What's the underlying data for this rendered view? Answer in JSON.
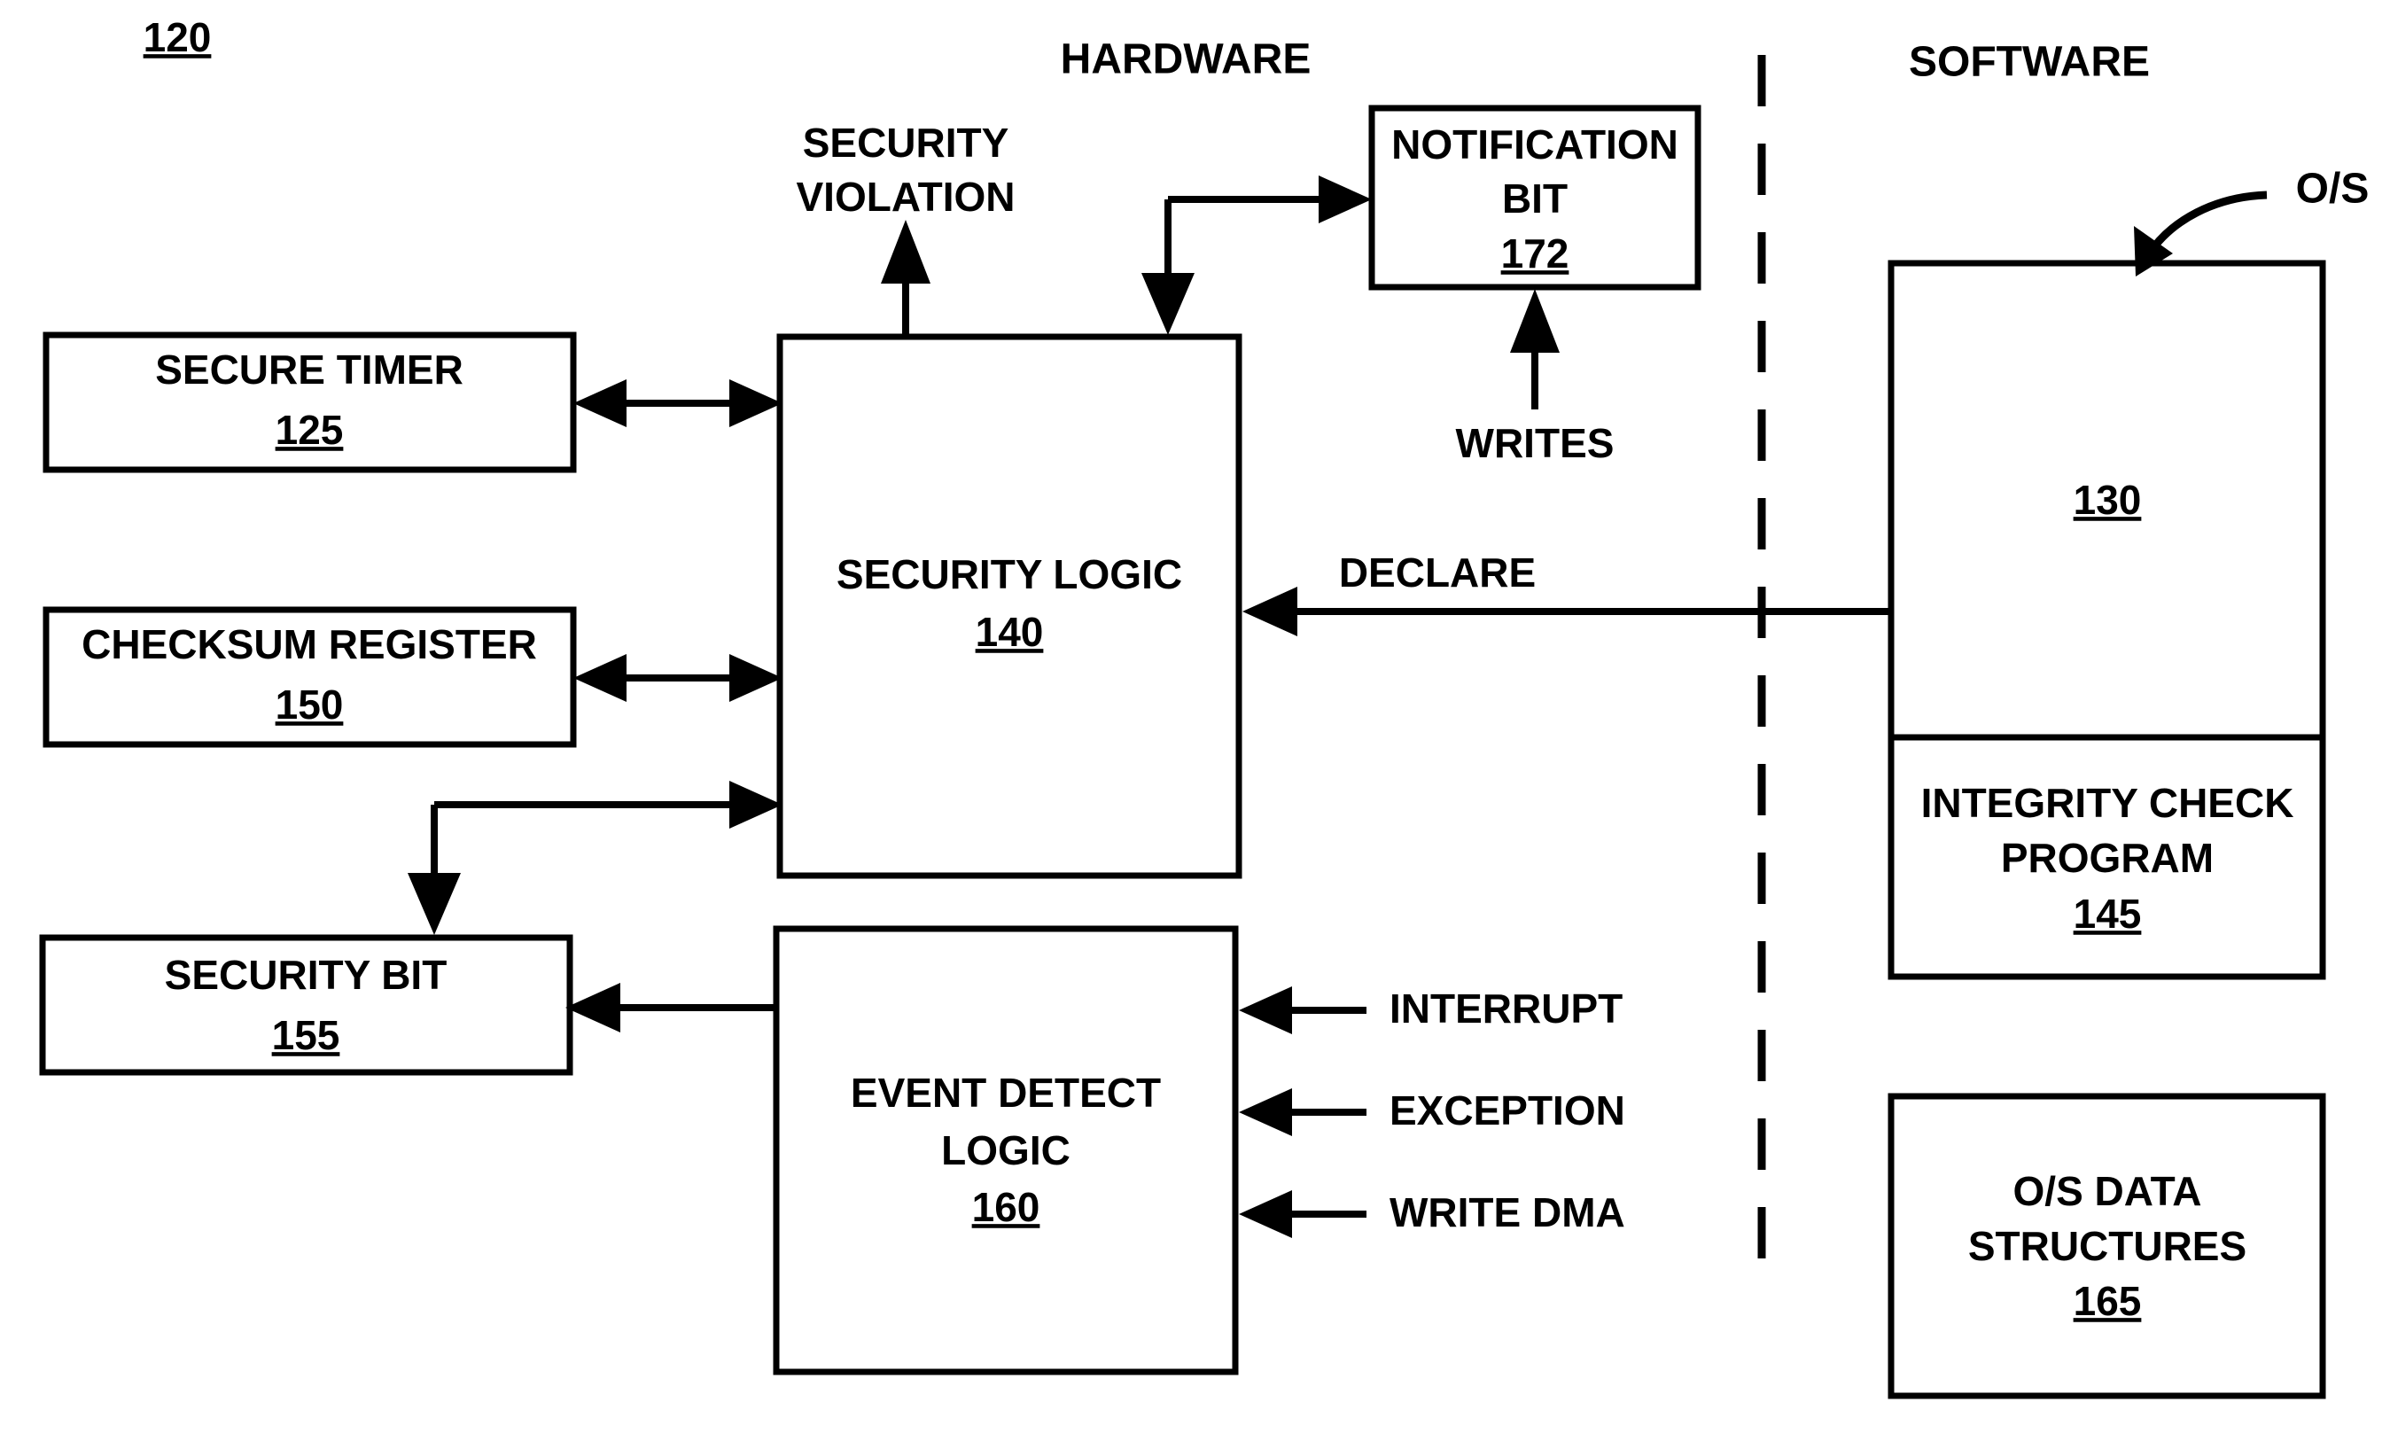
{
  "figure": {
    "figure_number": "120",
    "domain_headers": {
      "hardware": "HARDWARE",
      "software": "SOFTWARE"
    },
    "os_callout": "O/S"
  },
  "boxes": {
    "secure_timer": {
      "title": "SECURE TIMER",
      "ref": "125"
    },
    "checksum_register": {
      "title": "CHECKSUM REGISTER",
      "ref": "150"
    },
    "security_bit": {
      "title": "SECURITY BIT",
      "ref": "155"
    },
    "security_logic": {
      "title": "SECURITY LOGIC",
      "ref": "140"
    },
    "event_detect_logic": {
      "title_line1": "EVENT DETECT",
      "title_line2": "LOGIC",
      "ref": "160"
    },
    "notification_bit": {
      "title_line1": "NOTIFICATION",
      "title_line2": "BIT",
      "ref": "172"
    },
    "os": {
      "ref": "130"
    },
    "integrity_check_program": {
      "title_line1": "INTEGRITY CHECK",
      "title_line2": "PROGRAM",
      "ref": "145"
    },
    "os_data_structures": {
      "title_line1": "O/S DATA",
      "title_line2": "STRUCTURES",
      "ref": "165"
    }
  },
  "signals": {
    "security_violation_line1": "SECURITY",
    "security_violation_line2": "VIOLATION",
    "writes": "WRITES",
    "declare": "DECLARE",
    "interrupt": "INTERRUPT",
    "exception": "EXCEPTION",
    "write_dma": "WRITE DMA"
  },
  "colors": {
    "stroke": "#000000",
    "background": "#ffffff"
  }
}
